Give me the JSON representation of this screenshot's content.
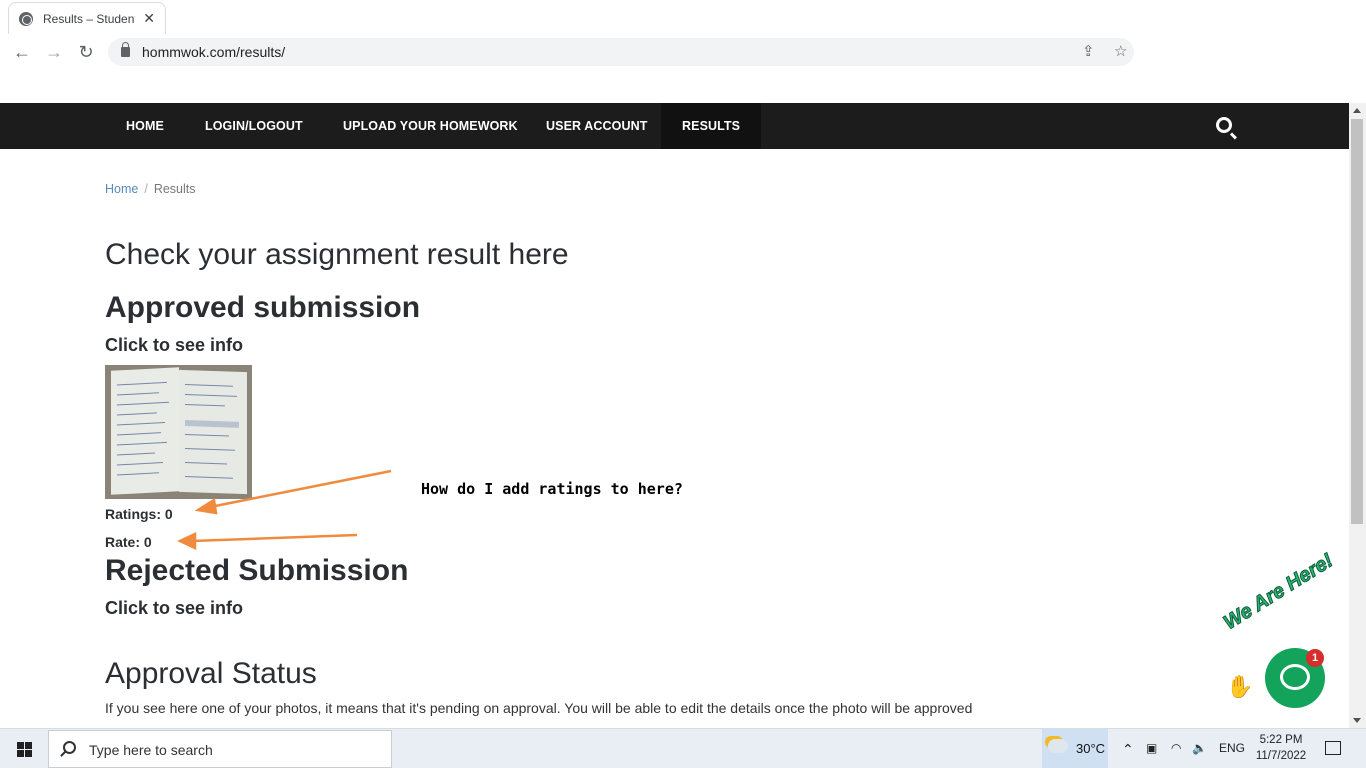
{
  "browser": {
    "tab_title": "Results – Student",
    "tab_close": "✕",
    "url": "hommwok.com/results/",
    "nav_back": "←",
    "nav_forward": "→",
    "nav_reload": "↻",
    "share_icon": "⇪",
    "star_icon": "☆"
  },
  "site_nav": {
    "items": [
      {
        "label": "HOME"
      },
      {
        "label": "LOGIN/LOGOUT"
      },
      {
        "label": "UPLOAD YOUR HOMEWORK"
      },
      {
        "label": "USER ACCOUNT"
      },
      {
        "label": "RESULTS"
      }
    ],
    "active": "RESULTS"
  },
  "breadcrumb": {
    "home": "Home",
    "separator": "/",
    "current": "Results"
  },
  "main": {
    "heading": "Check your assignment result here",
    "approved_heading": "Approved submission",
    "approved_click": "Click to see info",
    "ratings": "Ratings: 0",
    "rate": "Rate: 0",
    "rejected_heading": "Rejected Submission",
    "rejected_click": "Click to see info",
    "status_heading": "Approval Status",
    "status_text": "If you see here one of your photos, it means that it's pending on approval. You will be able to edit the details once the photo will be approved"
  },
  "annotation": {
    "text": "How do I add ratings to here?",
    "arrow_color": "#f08a3c"
  },
  "chat_widget": {
    "banner": "We Are Here!",
    "badge": "1",
    "color": "#14a35a"
  },
  "taskbar": {
    "search_placeholder": "Type here to search",
    "temperature": "30°C",
    "language": "ENG",
    "time": "5:22 PM",
    "date": "11/7/2022"
  }
}
